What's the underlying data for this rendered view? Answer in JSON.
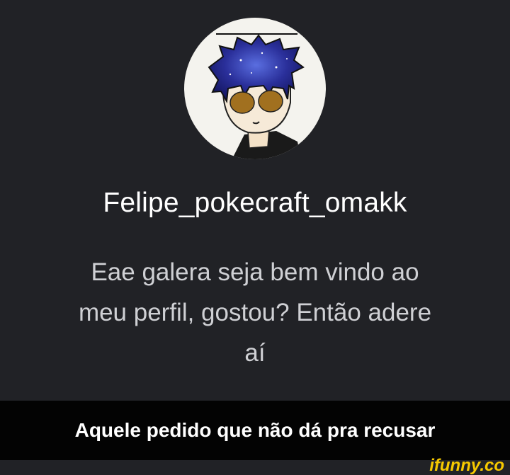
{
  "profile": {
    "username": "Felipe_pokecraft_omakk",
    "bio_lines": [
      "Eae galera seja bem vindo ao",
      "meu perfil, gostou?  Então adere",
      "aí"
    ]
  },
  "caption": "Aquele pedido que não dá pra recusar",
  "watermark": "ifunny.co",
  "colors": {
    "background": "#212226",
    "caption_bar": "#030303",
    "watermark": "#f7c900"
  }
}
